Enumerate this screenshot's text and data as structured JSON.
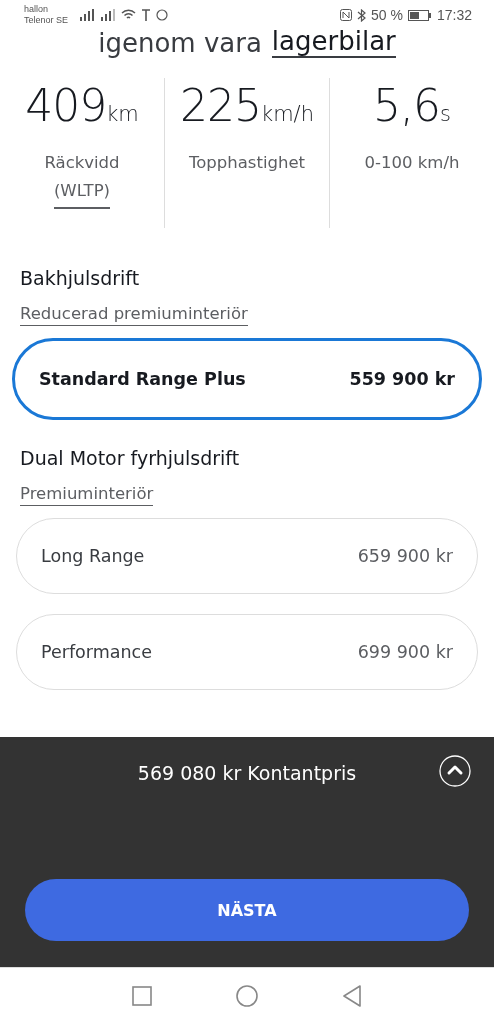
{
  "status_bar": {
    "carrier_top": "hallon",
    "carrier_bottom": "Telenor SE",
    "battery": "50 %",
    "time": "17:32"
  },
  "heading": {
    "text": "igenom vara",
    "link": "lagerbilar"
  },
  "specs": [
    {
      "value": "409",
      "unit": "km",
      "label": "Räckvidd",
      "link": "(WLTP)"
    },
    {
      "value": "225",
      "unit": "km/h",
      "label": "Topphastighet"
    },
    {
      "value": "5,6",
      "unit": "s",
      "label": "0-100 km/h"
    }
  ],
  "groups": [
    {
      "title": "Bakhjulsdrift",
      "interior": "Reducerad premiuminteriör",
      "options": [
        {
          "name": "Standard Range Plus",
          "price": "559 900 kr",
          "selected": true
        }
      ]
    },
    {
      "title": "Dual Motor fyrhjulsdrift",
      "interior": "Premiuminteriör",
      "options": [
        {
          "name": "Long Range",
          "price": "659 900 kr",
          "selected": false
        },
        {
          "name": "Performance",
          "price": "699 900 kr",
          "selected": false
        }
      ]
    }
  ],
  "footer": {
    "price": "569 080 kr",
    "price_label": "Kontantpris",
    "button": "NÄSTA"
  }
}
